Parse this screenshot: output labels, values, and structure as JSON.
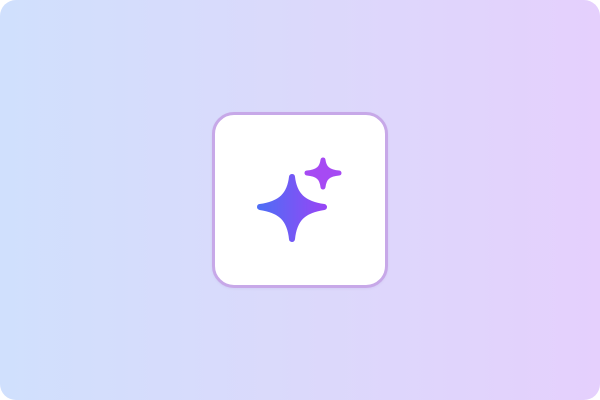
{
  "app_icon": {
    "icon": "sparkle-icon",
    "tile_border_color": "#c7a8e8",
    "tile_background": "#ffffff",
    "background_gradient": [
      "#d0e0fd",
      "#dbd9fb",
      "#e5d0fd"
    ],
    "sparkle_large_gradient": [
      "#4f6df5",
      "#9646f5"
    ],
    "sparkle_small_color": "#a64af3"
  }
}
